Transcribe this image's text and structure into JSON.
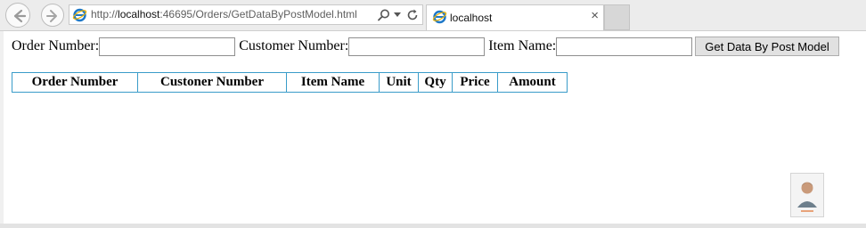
{
  "browser": {
    "url_prefix": "http://",
    "url_host": "localhost",
    "url_rest": ":46695/Orders/GetDataByPostModel.html",
    "tab_title": "localhost",
    "tab_close": "×"
  },
  "form": {
    "order_number_label": "Order Number:",
    "order_number_value": "",
    "customer_number_label": "Customer Number:",
    "customer_number_value": "",
    "item_name_label": "Item Name:",
    "item_name_value": "",
    "submit_label": "Get Data By Post Model"
  },
  "table": {
    "columns": [
      "Order Number",
      "Custoner Number",
      "Item Name",
      "Unit",
      "Qty",
      "Price",
      "Amount"
    ]
  },
  "colors": {
    "table_border": "#3a9cc9",
    "ie_blue": "#1e78c8",
    "ie_gold": "#f0b400"
  }
}
